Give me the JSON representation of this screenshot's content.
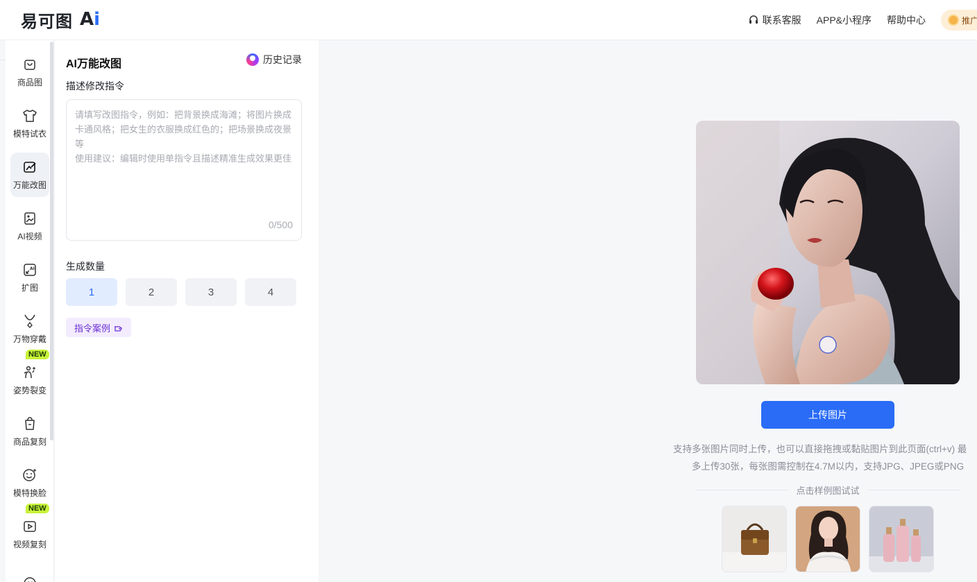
{
  "header": {
    "logo_text": "易可图",
    "logo_ai_a": "A",
    "logo_ai_i": "i",
    "nav": {
      "support": "联系客服",
      "app": "APP&小程序",
      "help": "帮助中心",
      "promo": "推广"
    }
  },
  "sidebar": {
    "items": [
      {
        "label": "商品图",
        "icon": "bag-icon"
      },
      {
        "label": "模特试衣",
        "icon": "tshirt-icon"
      },
      {
        "label": "万能改图",
        "icon": "edit-image-icon"
      },
      {
        "label": "AI视频",
        "icon": "video-icon"
      },
      {
        "label": "扩图",
        "icon": "expand-icon"
      },
      {
        "label": "万物穿戴",
        "icon": "necklace-icon"
      },
      {
        "label": "姿势裂变",
        "icon": "pose-icon",
        "badge": "NEW"
      },
      {
        "label": "商品复刻",
        "icon": "shopping-bag-icon"
      },
      {
        "label": "模特换脸",
        "icon": "face-icon"
      },
      {
        "label": "视频复刻",
        "icon": "video-copy-icon",
        "badge": "NEW"
      },
      {
        "label": "",
        "icon": "ai-icon"
      }
    ]
  },
  "panel": {
    "title": "AI万能改图",
    "history": "历史记录",
    "prompt_label": "描述修改指令",
    "prompt_placeholder": "请填写改图指令，例如：把背景换成海滩；将图片换成卡通风格；把女生的衣服换成红色的；把场景换成夜景等\n使用建议：编辑时使用单指令且描述精准生成效果更佳",
    "prompt_counter": "0/500",
    "quantity_label": "生成数量",
    "quantities": [
      "1",
      "2",
      "3",
      "4"
    ],
    "selected_quantity": "1",
    "examples_label": "指令案例"
  },
  "main": {
    "upload_button": "上传图片",
    "hint_line1": "支持多张图片同时上传，也可以直接拖拽或黏贴图片到此页面(ctrl+v) 最",
    "hint_line2": "多上传30张，每张图需控制在4.7M以内，支持JPG、JPEG或PNG",
    "samples_title": "点击样例图试试"
  },
  "colors": {
    "accent": "#2a6cf6",
    "badge_new": "#c8f33b",
    "examples_purple": "#6b2fd1"
  }
}
